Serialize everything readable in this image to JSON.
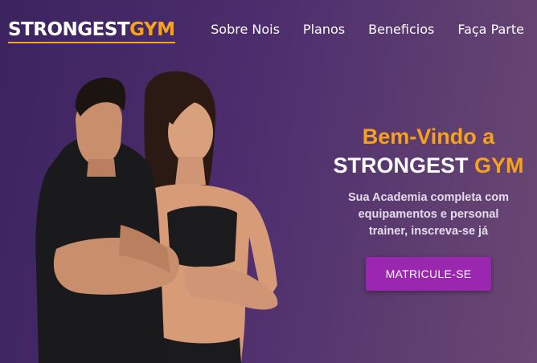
{
  "brand": {
    "part1": "STRONGEST",
    "part2": "GYM"
  },
  "nav": [
    {
      "label": "Sobre Nois"
    },
    {
      "label": "Planos"
    },
    {
      "label": "Beneficios"
    },
    {
      "label": "Faça Parte"
    }
  ],
  "hero": {
    "welcome": "Bem-Vindo a",
    "brand_part1": "STRONGEST ",
    "brand_part2": "GYM",
    "description": "Sua Academia completa com equipamentos e personal trainer, inscreva-se já",
    "cta_label": "MATRICULE-SE"
  },
  "colors": {
    "accent": "#f7a21b",
    "button": "#9b27b0",
    "background_start": "#3c2460",
    "background_end": "#6a4873"
  }
}
